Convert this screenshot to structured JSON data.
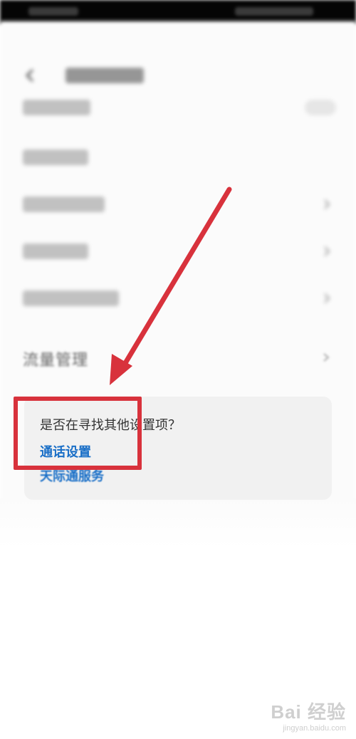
{
  "screen": {
    "header": {
      "back_icon": "back-arrow-icon",
      "title_blurred": true
    },
    "blurred_rows": [
      {
        "id": "row-1",
        "type": "toggle"
      },
      {
        "id": "row-2",
        "type": "link"
      },
      {
        "id": "row-3",
        "type": "chevron"
      },
      {
        "id": "row-4",
        "type": "chevron"
      },
      {
        "id": "row-5",
        "type": "chevron"
      }
    ],
    "traffic_row": {
      "label": "流量管理",
      "icon": "chevron-right-icon"
    },
    "suggestion": {
      "question": "是否在寻找其他设置项？",
      "links": [
        "通话设置",
        "天际通服务"
      ]
    },
    "annotation": {
      "highlight_color": "#d8323c",
      "arrow_color": "#d8323c"
    },
    "watermark": {
      "logo": "Bai 经验",
      "site": "jingyan.baidu.com"
    },
    "colors": {
      "link": "#1a6fc7",
      "card_bg": "#f1f1f1"
    }
  }
}
